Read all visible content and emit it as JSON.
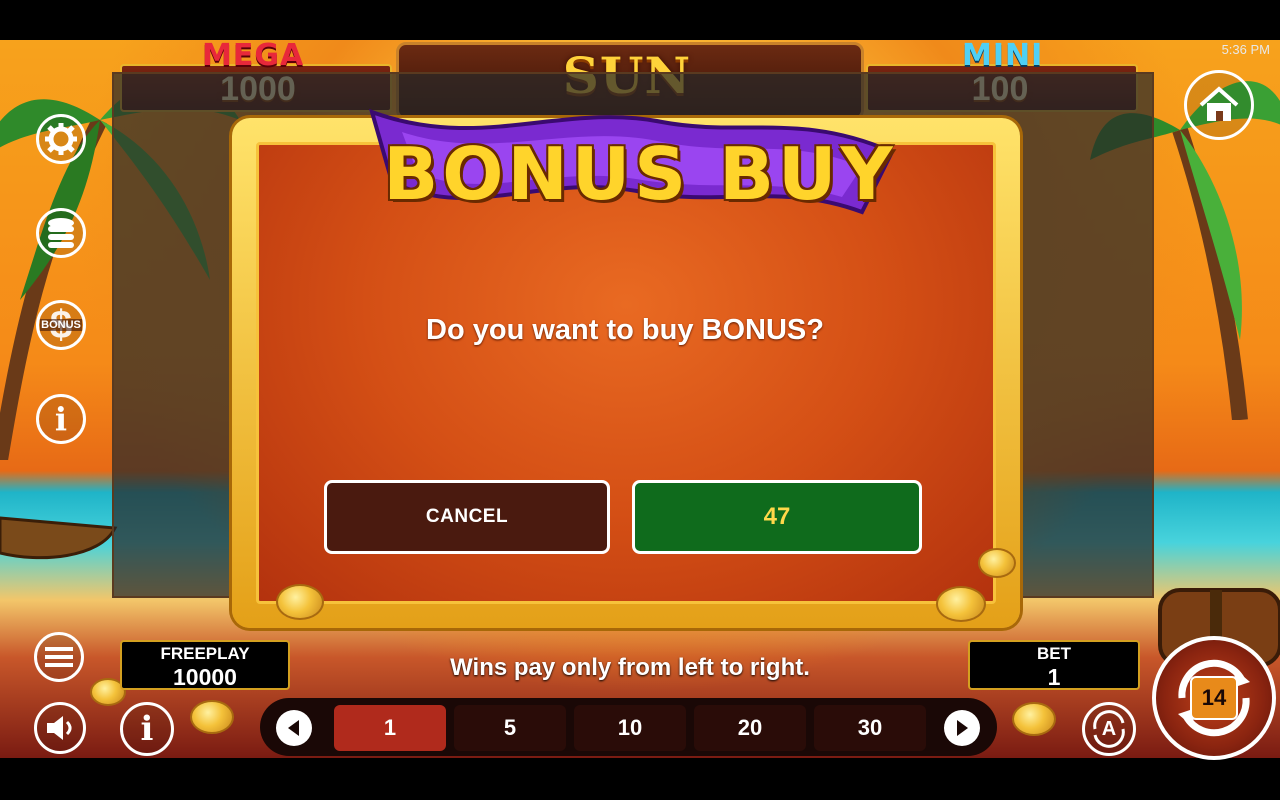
{
  "status": {
    "time": "5:36 PM"
  },
  "header": {
    "title": "SUN TREASURE",
    "mega": {
      "label": "MEGA",
      "value": "1000"
    },
    "mini": {
      "label": "MINI",
      "value": "100"
    }
  },
  "left_controls": [
    {
      "name": "settings",
      "icon": "gear-icon"
    },
    {
      "name": "coins",
      "icon": "coin-stack-icon"
    },
    {
      "name": "bonus",
      "icon": "bonus-dollar-icon",
      "label": "BONUS"
    },
    {
      "name": "info",
      "icon": "info-icon",
      "label": "i"
    }
  ],
  "dialog": {
    "title": "BONUS BUY",
    "question": "Do you want to buy BONUS?",
    "cancel_label": "CANCEL",
    "buy_label": "47"
  },
  "footer": {
    "freeplay": {
      "label": "FREEPLAY",
      "value": "10000"
    },
    "bet": {
      "label": "BET",
      "value": "1"
    },
    "message": "Wins pay only from left to right.",
    "bet_options": [
      "1",
      "5",
      "10",
      "20",
      "30"
    ],
    "selected_bet": "1",
    "spin_counter": "14",
    "auto_label": "A",
    "info_label": "i"
  },
  "colors": {
    "accent_gold": "#ffd42b",
    "buy_green": "#0f6b1c",
    "cancel_brown": "#4a1a0f",
    "mega_red": "#e8283a",
    "mini_blue": "#4fd0f5"
  }
}
